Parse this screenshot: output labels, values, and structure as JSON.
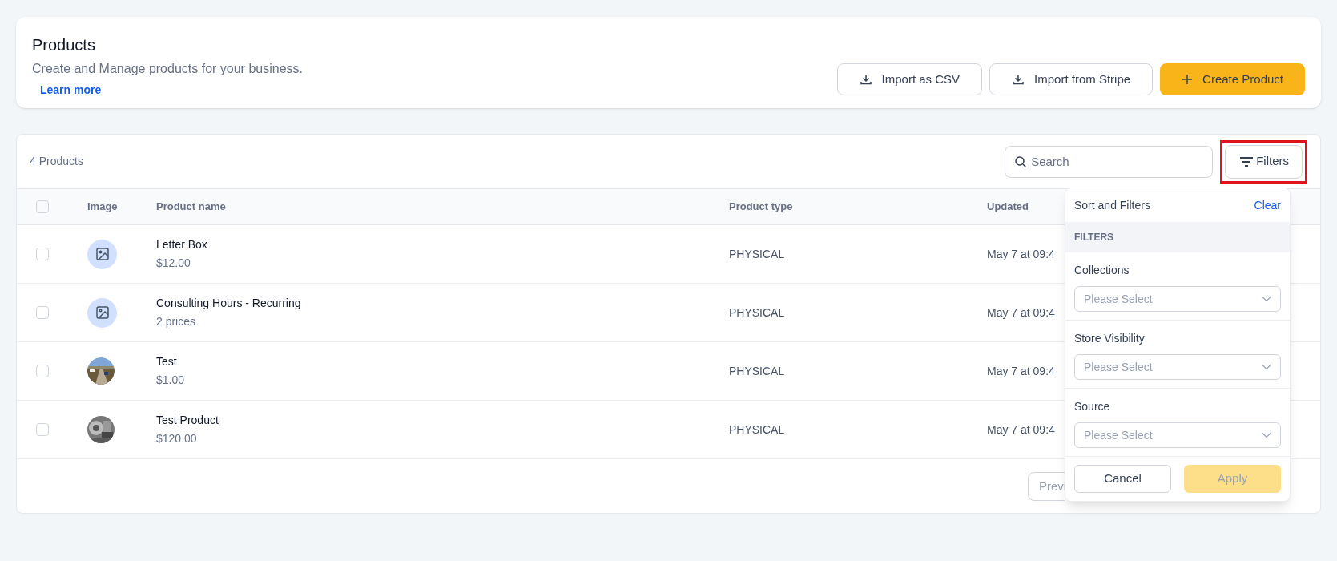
{
  "header": {
    "title": "Products",
    "subtitle": "Create and Manage products for your business.",
    "link": "Learn more",
    "buttons": [
      {
        "label": "Import as CSV",
        "kind": "import"
      },
      {
        "label": "Import from Stripe",
        "kind": "import"
      },
      {
        "label": "Create Product",
        "kind": "create"
      }
    ]
  },
  "table": {
    "count": "4 Products",
    "search": {
      "placeholder": "Search"
    },
    "filters_button": {
      "label": "Filters",
      "highlighted": true
    },
    "select_all": {
      "checked": false
    },
    "columns": [
      "Image",
      "Product name",
      "Product type",
      "Updated"
    ],
    "rows": [
      {
        "checked": false,
        "image": {
          "kind": "placeholder"
        },
        "name": "Letter Box",
        "detail": "$12.00",
        "type": "PHYSICAL",
        "updated": "May 7 at 09:4"
      },
      {
        "checked": false,
        "image": {
          "kind": "placeholder"
        },
        "name": "Consulting Hours - Recurring",
        "detail": "2 prices",
        "type": "PHYSICAL",
        "updated": "May 7 at 09:4"
      },
      {
        "checked": false,
        "name": "Test",
        "detail": "$1.00",
        "type": "PHYSICAL",
        "updated": "May 7 at 09:4"
      },
      {
        "checked": false,
        "name": "Test Product",
        "detail": "$120.00",
        "type": "PHYSICAL",
        "updated": "May 7 at 09:4"
      }
    ],
    "pagination": {
      "previous": "Previ"
    }
  },
  "filter_panel": {
    "title": "Sort and Filters",
    "clear": "Clear",
    "section": "FILTERS",
    "fields": [
      {
        "label": "Collections",
        "placeholder": "Please Select"
      },
      {
        "label": "Store Visibility",
        "placeholder": "Please Select"
      },
      {
        "label": "Source",
        "placeholder": "Please Select"
      }
    ],
    "cancel": "Cancel",
    "apply": {
      "label": "Apply",
      "disabled": true
    }
  }
}
